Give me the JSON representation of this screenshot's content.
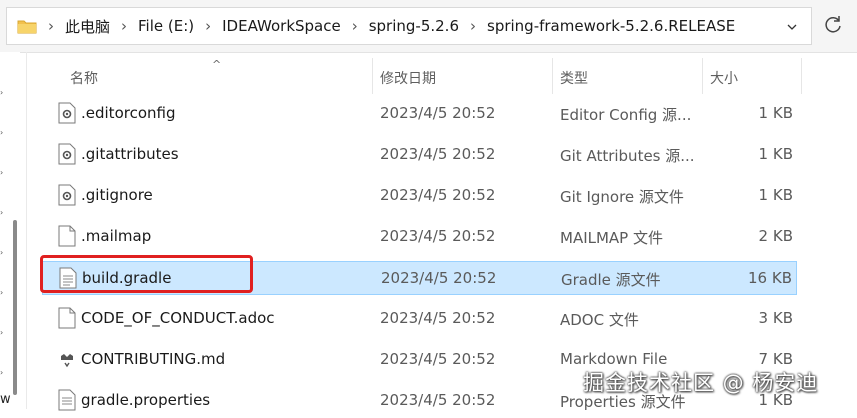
{
  "address_bar": {
    "crumbs": [
      "此电脑",
      "File (E:)",
      "IDEAWorkSpace",
      "spring-5.2.6",
      "spring-framework-5.2.6.RELEASE"
    ],
    "separator": "›"
  },
  "columns": {
    "name": "名称",
    "date": "修改日期",
    "type": "类型",
    "size": "大小"
  },
  "files": [
    {
      "name": ".editorconfig",
      "date": "2023/4/5 20:52",
      "type": "Editor Config 源...",
      "size": "1 KB",
      "icon": "config-file-icon"
    },
    {
      "name": ".gitattributes",
      "date": "2023/4/5 20:52",
      "type": "Git Attributes 源...",
      "size": "1 KB",
      "icon": "config-file-icon"
    },
    {
      "name": ".gitignore",
      "date": "2023/4/5 20:52",
      "type": "Git Ignore 源文件",
      "size": "1 KB",
      "icon": "config-file-icon"
    },
    {
      "name": ".mailmap",
      "date": "2023/4/5 20:52",
      "type": "MAILMAP 文件",
      "size": "2 KB",
      "icon": "blank-file-icon"
    },
    {
      "name": "build.gradle",
      "date": "2023/4/5 20:52",
      "type": "Gradle 源文件",
      "size": "16 KB",
      "icon": "text-file-icon",
      "selected": true
    },
    {
      "name": "CODE_OF_CONDUCT.adoc",
      "date": "2023/4/5 20:52",
      "type": "ADOC 文件",
      "size": "3 KB",
      "icon": "blank-file-icon"
    },
    {
      "name": "CONTRIBUTING.md",
      "date": "2023/4/5 20:52",
      "type": "Markdown File",
      "size": "7 KB",
      "icon": "markdown-file-icon"
    },
    {
      "name": "gradle.properties",
      "date": "2023/4/5 20:52",
      "type": "Properties 源文件",
      "size": "1 KB",
      "icon": "text-file-icon"
    }
  ],
  "nav": {
    "partial_label": "w"
  },
  "watermark": "掘金技术社区 @ 杨安迪",
  "colors": {
    "selection_bg": "#cce8ff",
    "selection_border": "#99d1ff",
    "highlight_box": "#e02020",
    "folder": "#f2c14e"
  }
}
